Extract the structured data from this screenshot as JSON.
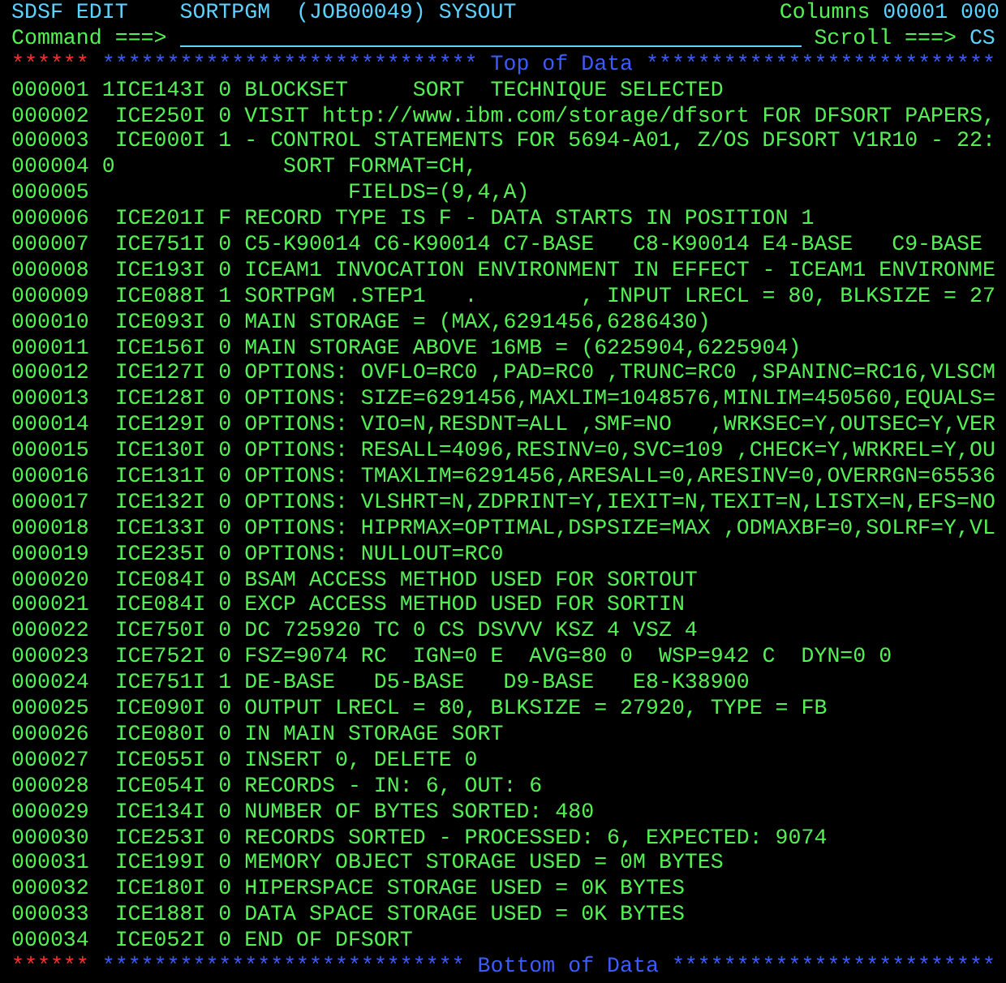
{
  "header": {
    "title": "SDSF EDIT    SORTPGM  (JOB00049) SYSOUT",
    "columns_label": "Columns",
    "columns_value": "00001 000"
  },
  "command": {
    "label": "Command ===>",
    "scroll_label": "Scroll ===>",
    "scroll_value": "CS"
  },
  "top_marker": {
    "stars_left": "****** *****************************",
    "label": "Top of Data",
    "stars_right": "***************************"
  },
  "lines": [
    {
      "number": "000001",
      "control": "1",
      "text": "ICE143I 0 BLOCKSET     SORT  TECHNIQUE SELECTED"
    },
    {
      "number": "000002",
      "text": "ICE250I 0 VISIT http://www.ibm.com/storage/dfsort FOR DFSORT PAPERS,"
    },
    {
      "number": "000003",
      "text": "ICE000I 1 - CONTROL STATEMENTS FOR 5694-A01, Z/OS DFSORT V1R10 - 22:"
    },
    {
      "number": "000004",
      "control": "0",
      "text": "             SORT FORMAT=CH,"
    },
    {
      "number": "000005",
      "text": "                  FIELDS=(9,4,A)"
    },
    {
      "number": "000006",
      "text": "ICE201I F RECORD TYPE IS F - DATA STARTS IN POSITION 1"
    },
    {
      "number": "000007",
      "text": "ICE751I 0 C5-K90014 C6-K90014 C7-BASE   C8-K90014 E4-BASE   C9-BASE"
    },
    {
      "number": "000008",
      "text": "ICE193I 0 ICEAM1 INVOCATION ENVIRONMENT IN EFFECT - ICEAM1 ENVIRONME"
    },
    {
      "number": "000009",
      "text": "ICE088I 1 SORTPGM .STEP1   .        , INPUT LRECL = 80, BLKSIZE = 27"
    },
    {
      "number": "000010",
      "text": "ICE093I 0 MAIN STORAGE = (MAX,6291456,6286430)"
    },
    {
      "number": "000011",
      "text": "ICE156I 0 MAIN STORAGE ABOVE 16MB = (6225904,6225904)"
    },
    {
      "number": "000012",
      "text": "ICE127I 0 OPTIONS: OVFLO=RC0 ,PAD=RC0 ,TRUNC=RC0 ,SPANINC=RC16,VLSCM"
    },
    {
      "number": "000013",
      "text": "ICE128I 0 OPTIONS: SIZE=6291456,MAXLIM=1048576,MINLIM=450560,EQUALS="
    },
    {
      "number": "000014",
      "text": "ICE129I 0 OPTIONS: VIO=N,RESDNT=ALL ,SMF=NO   ,WRKSEC=Y,OUTSEC=Y,VER"
    },
    {
      "number": "000015",
      "text": "ICE130I 0 OPTIONS: RESALL=4096,RESINV=0,SVC=109 ,CHECK=Y,WRKREL=Y,OU"
    },
    {
      "number": "000016",
      "text": "ICE131I 0 OPTIONS: TMAXLIM=6291456,ARESALL=0,ARESINV=0,OVERRGN=65536"
    },
    {
      "number": "000017",
      "text": "ICE132I 0 OPTIONS: VLSHRT=N,ZDPRINT=Y,IEXIT=N,TEXIT=N,LISTX=N,EFS=NO"
    },
    {
      "number": "000018",
      "text": "ICE133I 0 OPTIONS: HIPRMAX=OPTIMAL,DSPSIZE=MAX ,ODMAXBF=0,SOLRF=Y,VL"
    },
    {
      "number": "000019",
      "text": "ICE235I 0 OPTIONS: NULLOUT=RC0"
    },
    {
      "number": "000020",
      "text": "ICE084I 0 BSAM ACCESS METHOD USED FOR SORTOUT"
    },
    {
      "number": "000021",
      "text": "ICE084I 0 EXCP ACCESS METHOD USED FOR SORTIN"
    },
    {
      "number": "000022",
      "text": "ICE750I 0 DC 725920 TC 0 CS DSVVV KSZ 4 VSZ 4"
    },
    {
      "number": "000023",
      "text": "ICE752I 0 FSZ=9074 RC  IGN=0 E  AVG=80 0  WSP=942 C  DYN=0 0"
    },
    {
      "number": "000024",
      "text": "ICE751I 1 DE-BASE   D5-BASE   D9-BASE   E8-K38900"
    },
    {
      "number": "000025",
      "text": "ICE090I 0 OUTPUT LRECL = 80, BLKSIZE = 27920, TYPE = FB"
    },
    {
      "number": "000026",
      "text": "ICE080I 0 IN MAIN STORAGE SORT"
    },
    {
      "number": "000027",
      "text": "ICE055I 0 INSERT 0, DELETE 0"
    },
    {
      "number": "000028",
      "text": "ICE054I 0 RECORDS - IN: 6, OUT: 6"
    },
    {
      "number": "000029",
      "text": "ICE134I 0 NUMBER OF BYTES SORTED: 480"
    },
    {
      "number": "000030",
      "text": "ICE253I 0 RECORDS SORTED - PROCESSED: 6, EXPECTED: 9074"
    },
    {
      "number": "000031",
      "text": "ICE199I 0 MEMORY OBJECT STORAGE USED = 0M BYTES"
    },
    {
      "number": "000032",
      "text": "ICE180I 0 HIPERSPACE STORAGE USED = 0K BYTES"
    },
    {
      "number": "000033",
      "text": "ICE188I 0 DATA SPACE STORAGE USED = 0K BYTES"
    },
    {
      "number": "000034",
      "text": "ICE052I 0 END OF DFSORT"
    }
  ],
  "bottom_marker": {
    "stars_left": "****** ****************************",
    "label": "Bottom of Data",
    "stars_right": "*************************"
  }
}
